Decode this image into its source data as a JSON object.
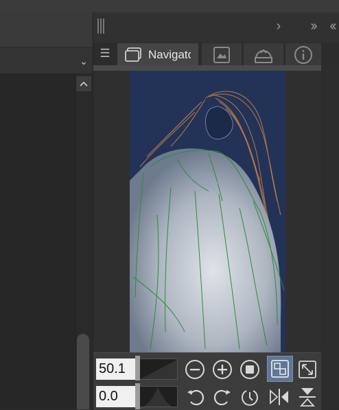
{
  "navigator_panel": {
    "tab_label": "Navigator",
    "zoom_value": "50.1",
    "rotate_value": "0.0"
  },
  "colors": {
    "canvas_background": "#233357",
    "panel": "#313131",
    "accent_button": "#5f7696"
  },
  "icons": {
    "tab_1": "navigator-icon",
    "tab_2": "sub-view-icon",
    "tab_3": "layer-property-icon",
    "tab_4": "info-icon",
    "zoom_out": "zoom-out-icon",
    "zoom_in": "zoom-in-icon",
    "actual_size": "actual-size-icon",
    "fit_to_navigator": "fit-to-navigator-icon",
    "fit_to_window": "fit-to-window-icon",
    "rotate_left": "rotate-left-icon",
    "rotate_right": "rotate-right-icon",
    "reset_rotation": "reset-rotation-icon",
    "flip_horizontal": "flip-horizontal-icon",
    "flip_vertical": "flip-vertical-icon"
  }
}
